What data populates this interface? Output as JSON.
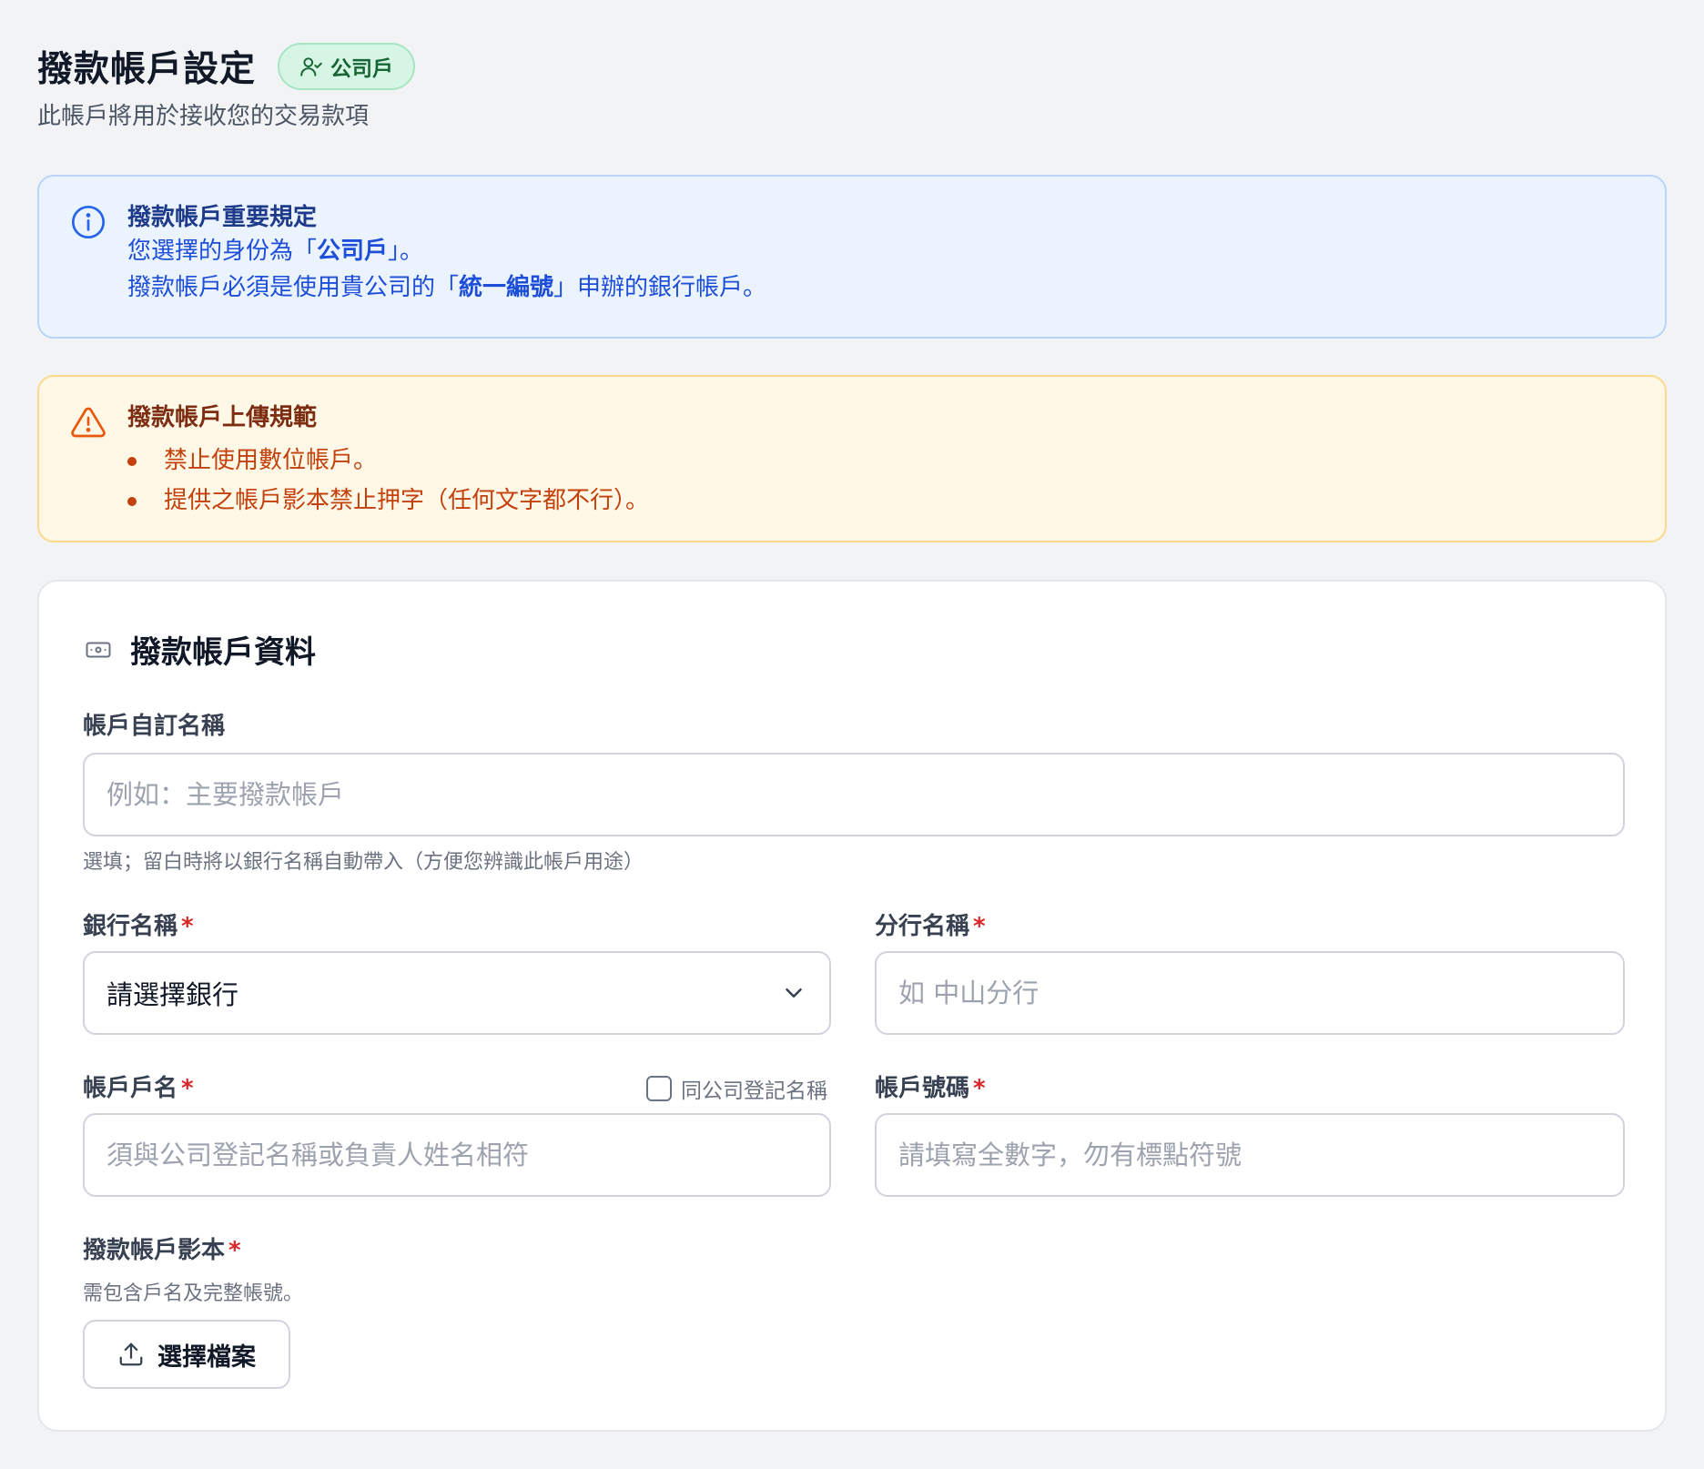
{
  "header": {
    "title": "撥款帳戶設定",
    "badge": "公司戶",
    "subtitle": "此帳戶將用於接收您的交易款項"
  },
  "info_alert": {
    "title": "撥款帳戶重要規定",
    "line1_prefix": "您選擇的身份為「",
    "line1_bold": "公司戶",
    "line1_suffix": "」。",
    "line2_prefix": "撥款帳戶必須是使用貴公司的「",
    "line2_bold": "統一編號",
    "line2_suffix": "」申辦的銀行帳戶。"
  },
  "warn_alert": {
    "title": "撥款帳戶上傳規範",
    "items": [
      "禁止使用數位帳戶。",
      "提供之帳戶影本禁止押字（任何文字都不行）。"
    ]
  },
  "form": {
    "section_title": "撥款帳戶資料",
    "alias": {
      "label": "帳戶自訂名稱",
      "placeholder": "例如：主要撥款帳戶",
      "hint": "選填；留白時將以銀行名稱自動帶入（方便您辨識此帳戶用途）"
    },
    "bank": {
      "label": "銀行名稱",
      "selected": "請選擇銀行"
    },
    "branch": {
      "label": "分行名稱",
      "placeholder": "如 中山分行"
    },
    "holder": {
      "label": "帳戶戶名",
      "placeholder": "須與公司登記名稱或負責人姓名相符",
      "same_checkbox_label": "同公司登記名稱"
    },
    "account_no": {
      "label": "帳戶號碼",
      "placeholder": "請填寫全數字，勿有標點符號"
    },
    "copy": {
      "label": "撥款帳戶影本",
      "hint": "需包含戶名及完整帳號。",
      "button": "選擇檔案"
    },
    "required_mark": "*"
  },
  "colors": {
    "background": "#f2f3f5",
    "info_bg": "#ebf3fe",
    "warn_bg": "#fff8e6",
    "badge_bg": "#d6f5e4",
    "required": "#dc2626"
  },
  "icons": [
    "user-check-icon",
    "info-circle-icon",
    "warning-triangle-icon",
    "banknote-icon",
    "chevron-down-icon",
    "upload-icon"
  ]
}
